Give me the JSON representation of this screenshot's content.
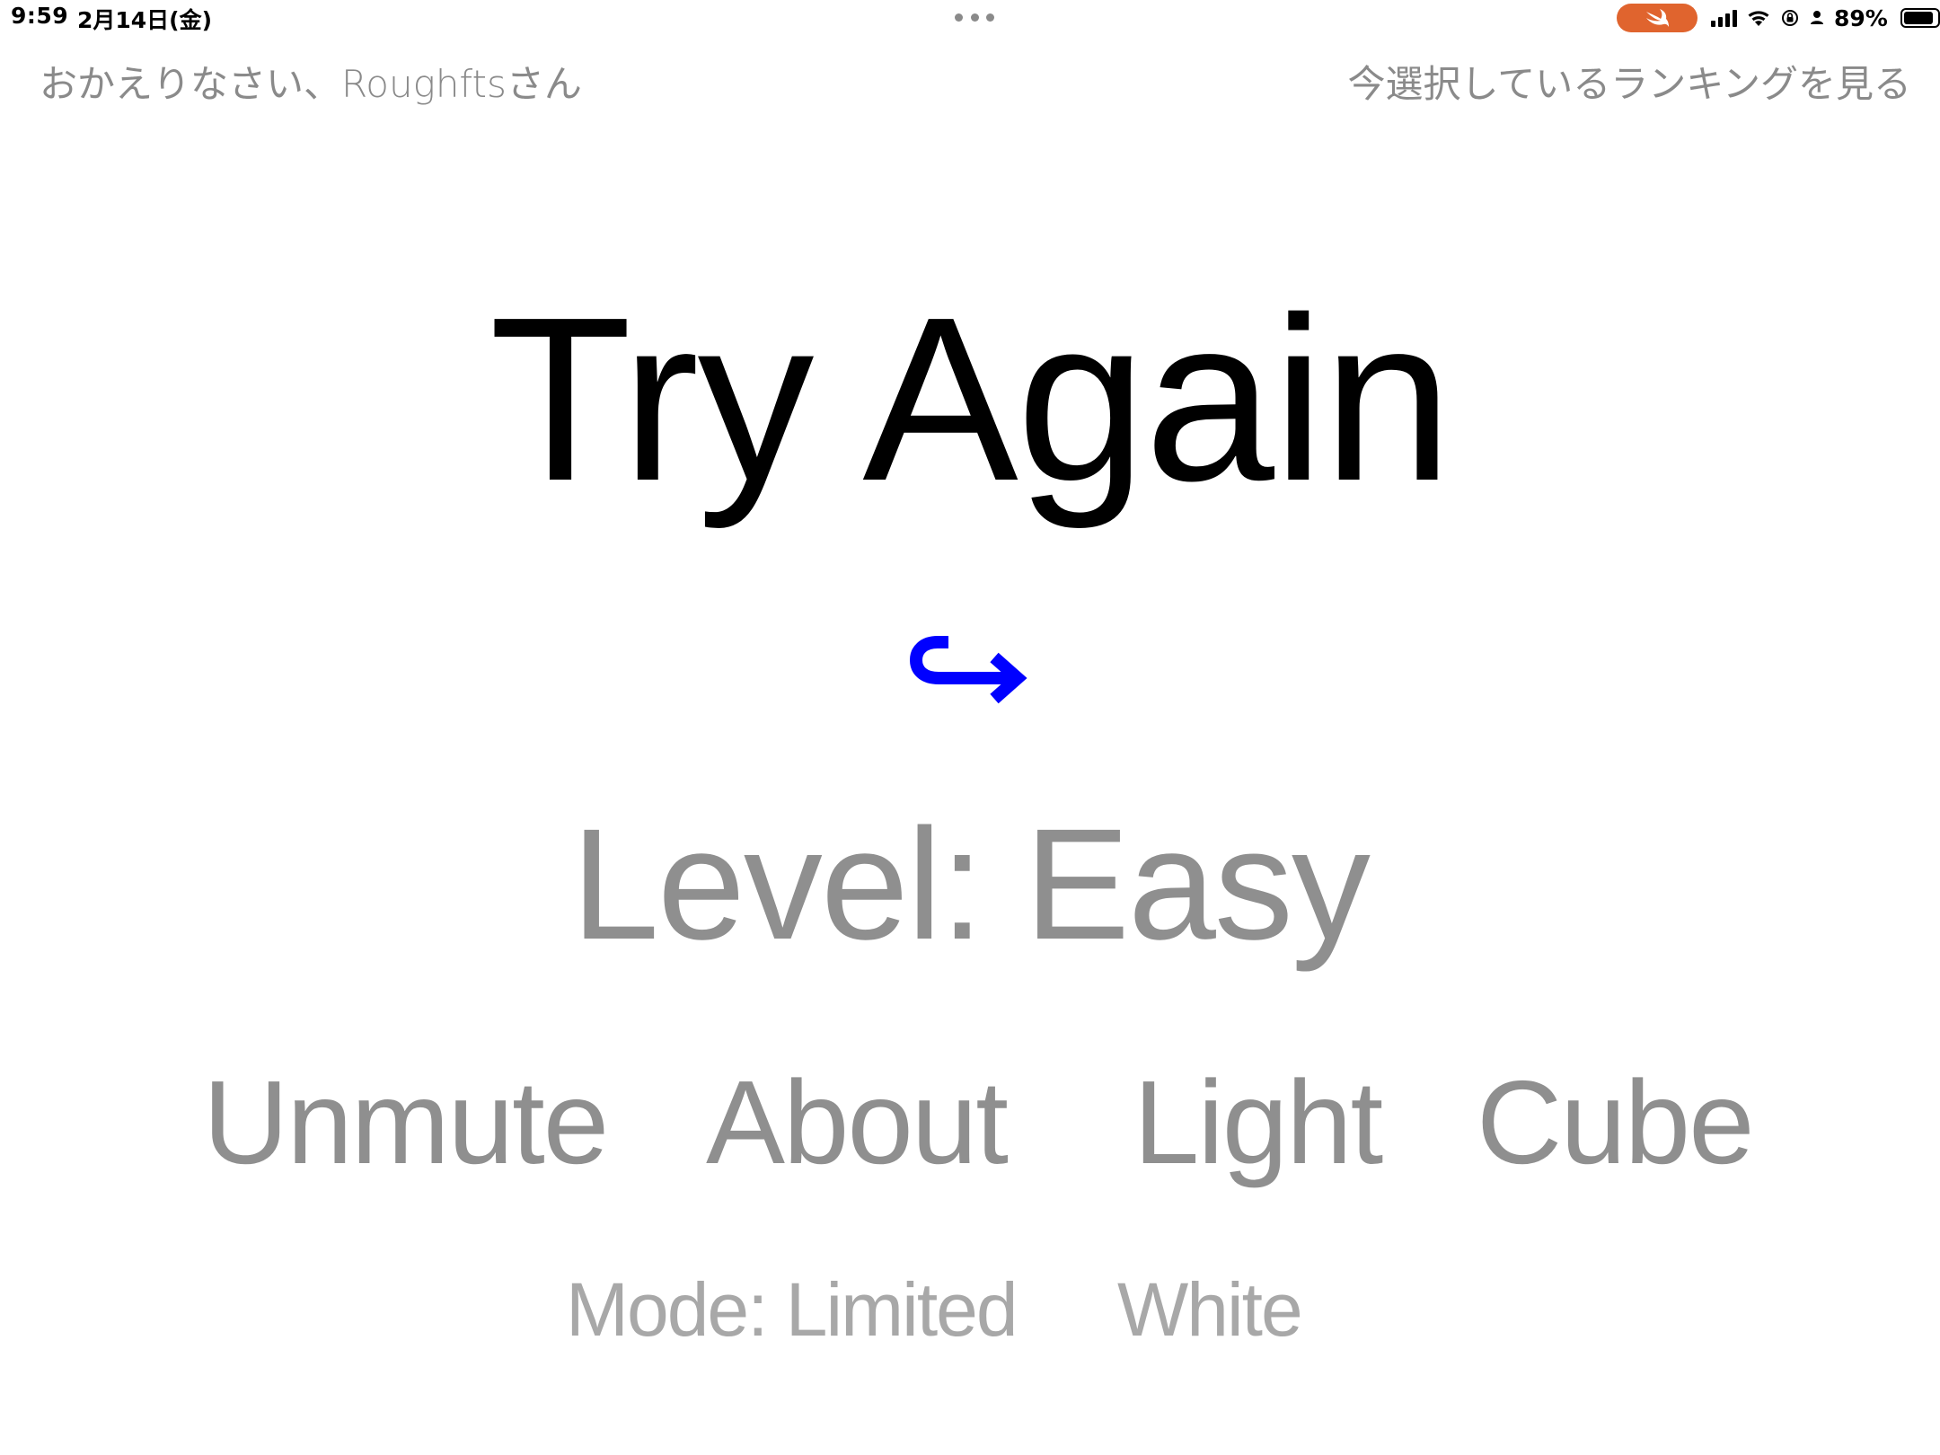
{
  "status_bar": {
    "time": "9:59",
    "date": "2月14日(金)",
    "battery_percent": "89%",
    "battery_level": 0.89,
    "swift_pill_color": "#e0642e"
  },
  "header": {
    "welcome": "おかえりなさい、Roughftsさん",
    "ranking_link": "今選択しているランキングを見る"
  },
  "main": {
    "title": "Try Again",
    "retry_icon": "return-arrow-icon",
    "retry_icon_color": "#0000ff",
    "level": "Level: Easy"
  },
  "menu": {
    "unmute": "Unmute",
    "about": "About",
    "light": "Light",
    "cube": "Cube"
  },
  "options": {
    "mode": "Mode: Limited",
    "color": "White"
  }
}
